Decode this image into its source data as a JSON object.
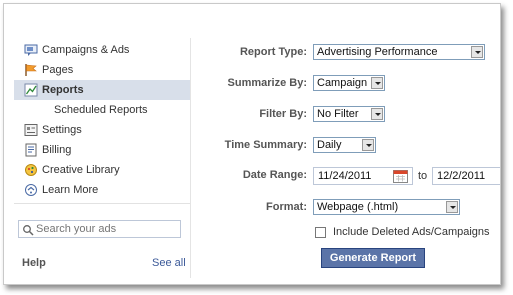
{
  "sidebar": {
    "items": [
      {
        "label": "Campaigns & Ads",
        "icon": "campaigns-icon"
      },
      {
        "label": "Pages",
        "icon": "flag-icon"
      },
      {
        "label": "Reports",
        "icon": "chart-icon"
      },
      {
        "label": "Scheduled Reports",
        "icon": ""
      },
      {
        "label": "Settings",
        "icon": "settings-icon"
      },
      {
        "label": "Billing",
        "icon": "billing-icon"
      },
      {
        "label": "Creative Library",
        "icon": "creative-library-icon"
      },
      {
        "label": "Learn More",
        "icon": "learn-more-icon"
      }
    ],
    "active_index": 2,
    "search": {
      "placeholder": "Search your ads"
    },
    "help": {
      "label": "Help",
      "see_all": "See all"
    }
  },
  "form": {
    "report_type": {
      "label": "Report Type:",
      "value": "Advertising Performance"
    },
    "summarize_by": {
      "label": "Summarize By:",
      "value": "Campaign"
    },
    "filter_by": {
      "label": "Filter By:",
      "value": "No Filter"
    },
    "time_summary": {
      "label": "Time Summary:",
      "value": "Daily"
    },
    "date_range": {
      "label": "Date Range:",
      "start": "11/24/2011",
      "to_label": "to",
      "end": "12/2/2011"
    },
    "format": {
      "label": "Format:",
      "value": "Webpage (.html)"
    },
    "include_deleted": {
      "label": "Include Deleted Ads/Campaigns",
      "checked": false
    },
    "generate_button": "Generate Report"
  },
  "colors": {
    "accent": "#3b5998",
    "button": "#5b74a8",
    "active_nav": "#d8dfea"
  }
}
